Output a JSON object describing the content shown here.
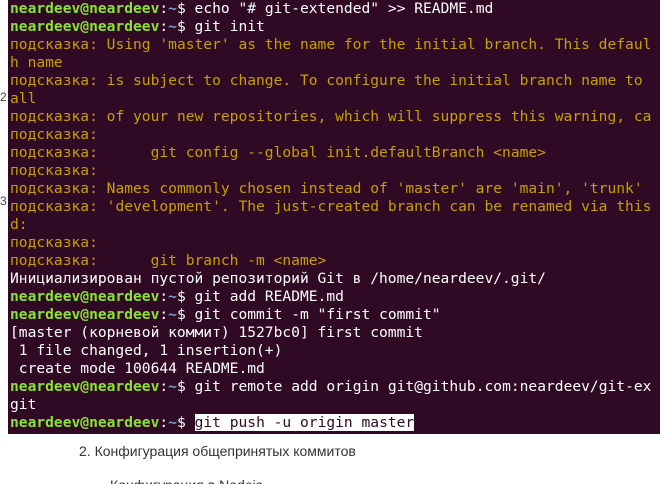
{
  "document": {
    "margin_markers": [
      "2",
      "3"
    ],
    "list_item": "2. Конфигурация общепринятых коммитов",
    "partial_line": "Конфигурация в           Nodejs"
  },
  "terminal": {
    "prompt": {
      "user": "neardeev@neardeev",
      "colon": ":",
      "path": "~",
      "symbol": "$"
    },
    "lines": [
      {
        "kind": "cmd",
        "text": " echo \"# git-extended\" >> README.md"
      },
      {
        "kind": "cmd",
        "text": " git init"
      },
      {
        "kind": "hint",
        "label": "подсказка:",
        "text": " Using 'master' as the name for the initial branch. This defaul"
      },
      {
        "kind": "hintcont",
        "text": "h name"
      },
      {
        "kind": "hint",
        "label": "подсказка:",
        "text": " is subject to change. To configure the initial branch name to"
      },
      {
        "kind": "hintcont",
        "text": "all"
      },
      {
        "kind": "hint",
        "label": "подсказка:",
        "text": " of your new repositories, which will suppress this warning, ca"
      },
      {
        "kind": "hint",
        "label": "подсказка:",
        "text": ""
      },
      {
        "kind": "hint",
        "label": "подсказка:",
        "text": " \tgit config --global init.defaultBranch <name>"
      },
      {
        "kind": "hint",
        "label": "подсказка:",
        "text": ""
      },
      {
        "kind": "hint",
        "label": "подсказка:",
        "text": " Names commonly chosen instead of 'master' are 'main', 'trunk'"
      },
      {
        "kind": "hint",
        "label": "подсказка:",
        "text": " 'development'. The just-created branch can be renamed via this"
      },
      {
        "kind": "hintcont",
        "text": "d:"
      },
      {
        "kind": "hint",
        "label": "подсказка:",
        "text": ""
      },
      {
        "kind": "hint",
        "label": "подсказка:",
        "text": " \tgit branch -m <name>"
      },
      {
        "kind": "out",
        "text": "Инициализирован пустой репозиторий Git в /home/neardeev/.git/"
      },
      {
        "kind": "cmd",
        "text": " git add README.md"
      },
      {
        "kind": "cmd",
        "text": " git commit -m \"first commit\""
      },
      {
        "kind": "out",
        "text": "[master (корневой коммит) 1527bc0] first commit"
      },
      {
        "kind": "out",
        "text": " 1 file changed, 1 insertion(+)"
      },
      {
        "kind": "out",
        "text": " create mode 100644 README.md"
      },
      {
        "kind": "cmd",
        "text": " git remote add origin git@github.com:neardeev/git-ex"
      },
      {
        "kind": "out",
        "text": "git"
      },
      {
        "kind": "cmdsel",
        "text": "git push -u origin master"
      }
    ]
  }
}
